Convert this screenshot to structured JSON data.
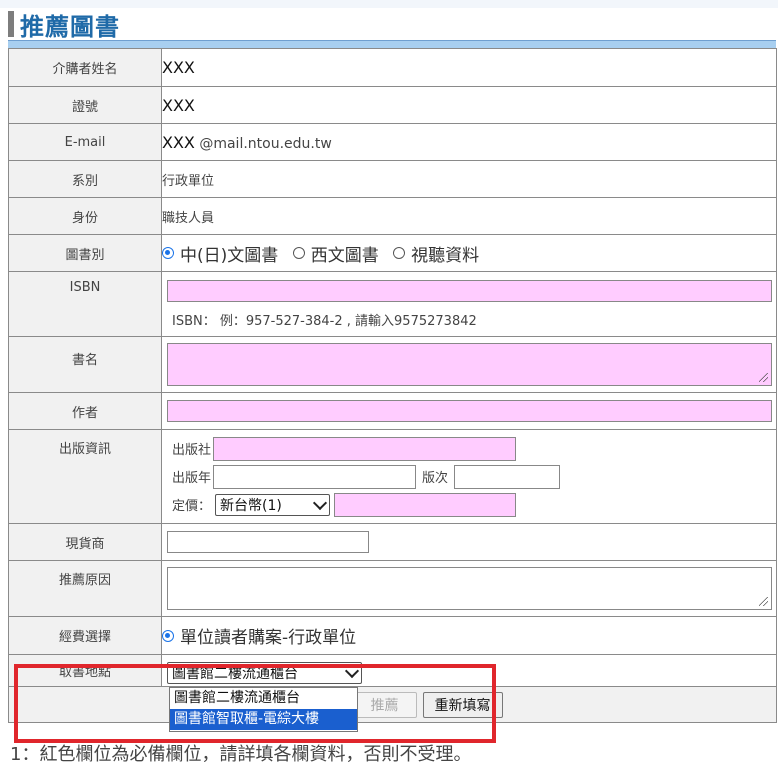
{
  "page": {
    "title": "推薦圖書",
    "note": "1：紅色欄位為必備欄位，請詳填各欄資料，否則不受理。"
  },
  "fields": {
    "recommender_name": {
      "label": "介購者姓名",
      "value": "XXX"
    },
    "id_no": {
      "label": "證號",
      "value": "XXX"
    },
    "email": {
      "label": "E-mail",
      "value": "XXX",
      "domain": "@mail.ntou.edu.tw"
    },
    "department": {
      "label": "系別",
      "value": "行政單位"
    },
    "identity": {
      "label": "身份",
      "value": "職技人員"
    },
    "book_type": {
      "label": "圖書別",
      "options": [
        "中(日)文圖書",
        "西文圖書",
        "視聽資料"
      ],
      "selected": "中(日)文圖書"
    },
    "isbn": {
      "label": "ISBN",
      "hint": "ISBN： 例：957-527-384-2 , 請輸入9575273842"
    },
    "book_title": {
      "label": "書名"
    },
    "author": {
      "label": "作者"
    },
    "publication": {
      "label": "出版資訊",
      "publisher_label": "出版社",
      "year_label": "出版年",
      "edition_label": "版次",
      "price_label": "定價：",
      "currency_selected": "新台幣(1)"
    },
    "vendor": {
      "label": "現貨商"
    },
    "reason": {
      "label": "推薦原因"
    },
    "funding": {
      "label": "經費選擇",
      "selected": "單位讀者購案-行政單位"
    },
    "pickup": {
      "label": "取書地點",
      "selected": "圖書館二樓流通櫃台",
      "options": [
        "圖書館二樓流通櫃台",
        "圖書館智取櫃-電綜大樓"
      ],
      "highlighted": "圖書館智取櫃-電綜大樓"
    }
  },
  "actions": {
    "submit_label": "推薦",
    "reset_label": "重新填寫"
  }
}
